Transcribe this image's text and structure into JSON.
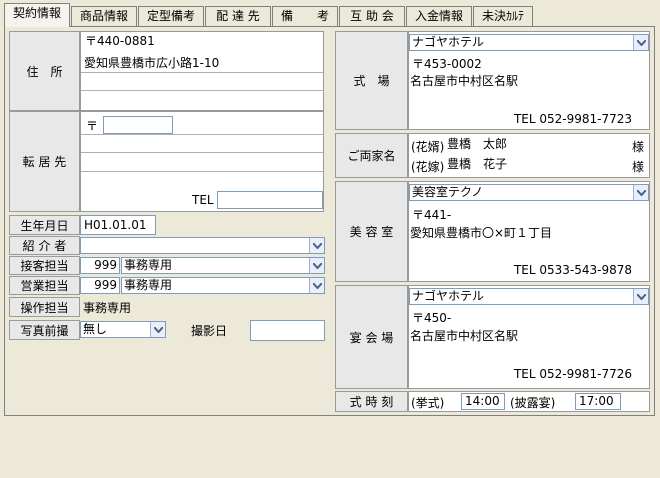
{
  "tabs": [
    "契約情報",
    "商品情報",
    "定型備考",
    "配 達 先",
    "備　　考",
    "互 助 会",
    "入金情報",
    "未決ｶﾙﾃ"
  ],
  "left": {
    "address_label": "住　所",
    "address_zip": "〒440-0881",
    "address_line": "愛知県豊橋市広小路1-10",
    "forward_label": "転 居 先",
    "forward_zip": "〒",
    "forward_tel_label": "TEL",
    "birth_label": "生年月日",
    "birth_value": "H01.01.01",
    "referrer_label": "紹 介 者",
    "reception_label": "接客担当",
    "reception_code": "999",
    "reception_name": "事務専用",
    "sales_label": "営業担当",
    "sales_code": "999",
    "sales_name": "事務専用",
    "operator_label": "操作担当",
    "operator_name": "事務専用",
    "photo_label": "写真前撮",
    "photo_value": "無し",
    "shoot_date_label": "撮影日"
  },
  "right": {
    "ceremony_label": "式　場",
    "ceremony_name": "ナゴヤホテル",
    "ceremony_zip": "〒453-0002",
    "ceremony_address": "名古屋市中村区名駅",
    "ceremony_tel": "TEL 052-9981-7723",
    "family_label": "ご両家名",
    "groom_prefix": "(花婿)",
    "groom_name": "豊橋　太郎",
    "bride_prefix": "(花嫁)",
    "bride_name": "豊橋　花子",
    "honorific": "様",
    "salon_label": "美 容 室",
    "salon_name": "美容室テクノ",
    "salon_zip": "〒441-",
    "salon_address": "愛知県豊橋市〇×町１丁目",
    "salon_tel": "TEL 0533-543-9878",
    "banquet_label": "宴 会 場",
    "banquet_name": "ナゴヤホテル",
    "banquet_zip": "〒450-",
    "banquet_address": "名古屋市中村区名駅",
    "banquet_tel": "TEL 052-9981-7726",
    "time_label": "式 時 刻",
    "ceremony_time_label": "(挙式)",
    "ceremony_time": "14:00",
    "reception_time_label": "(披露宴)",
    "reception_time": "17:00"
  },
  "icons": {
    "dropdown": "chevron-down-icon"
  }
}
